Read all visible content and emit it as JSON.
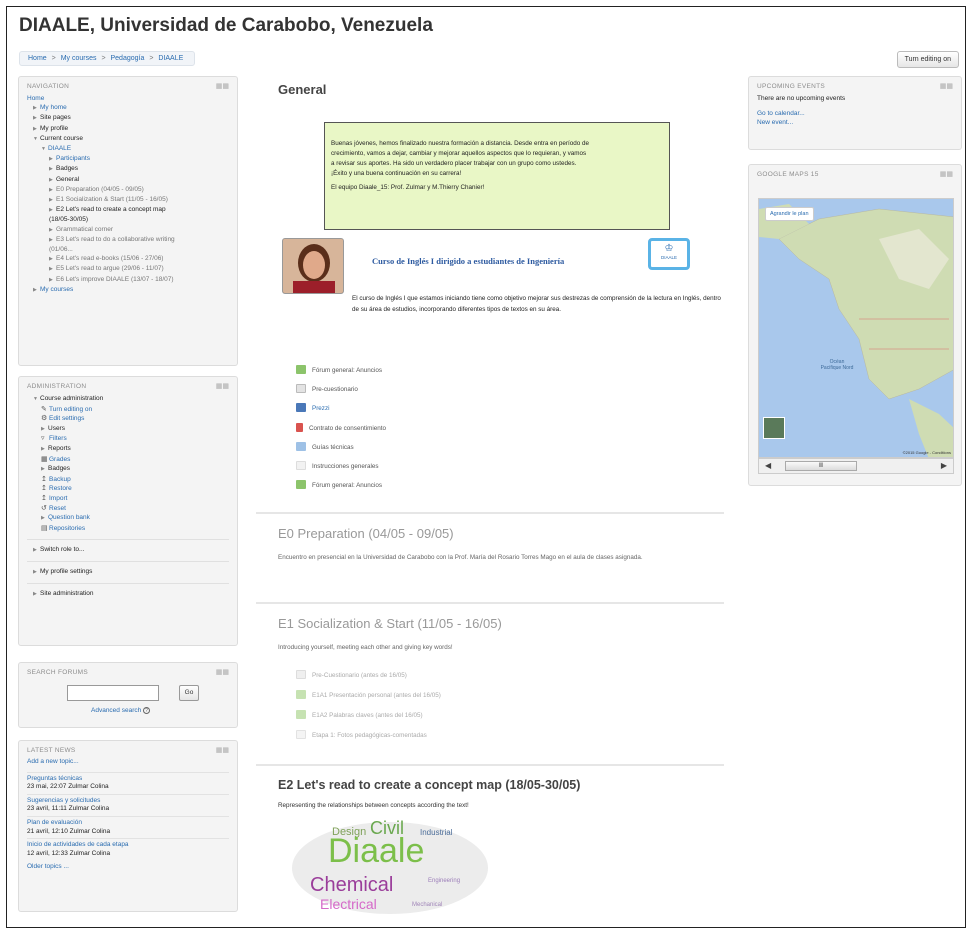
{
  "site_title": "DIAALE, Universidad de Carabobo, Venezuela",
  "breadcrumb": [
    "Home",
    "My courses",
    "Pedagogía",
    "DIAALE"
  ],
  "breadcrumb_sep": ">",
  "turn_editing_button": "Turn editing on",
  "navigation": {
    "title": "NAVIGATION",
    "home": "Home",
    "items": [
      "My home",
      "Site pages",
      "My profile",
      "Current course"
    ],
    "course": "DIAALE",
    "course_items": [
      "Participants",
      "Badges",
      "General",
      "E0 Preparation (04/05 - 09/05)",
      "E1 Socialization & Start (11/05 - 16/05)",
      "E2 Let's read to create a concept map (18/05-30/05)",
      "Grammatical corner",
      "E3 Let's read to do a collaborative writing (01/06...",
      "E4 Let's read e-books (15/06 - 27/06)",
      "E5 Let's read to argue (29/06 - 11/07)",
      "E6 Let's improve DIAALE (13/07 - 18/07)"
    ],
    "my_courses": "My courses"
  },
  "administration": {
    "title": "ADMINISTRATION",
    "course_admin": "Course administration",
    "items": [
      {
        "label": "Turn editing on",
        "icon": "pencil-icon"
      },
      {
        "label": "Edit settings",
        "icon": "gear-icon"
      },
      {
        "label": "Users",
        "icon": "triangle-icon"
      },
      {
        "label": "Filters",
        "icon": "filter-icon"
      },
      {
        "label": "Reports",
        "icon": "triangle-icon"
      },
      {
        "label": "Grades",
        "icon": "grades-icon"
      },
      {
        "label": "Badges",
        "icon": "triangle-icon"
      },
      {
        "label": "Backup",
        "icon": "backup-icon"
      },
      {
        "label": "Restore",
        "icon": "restore-icon"
      },
      {
        "label": "Import",
        "icon": "import-icon"
      },
      {
        "label": "Reset",
        "icon": "reset-icon"
      },
      {
        "label": "Question bank",
        "icon": "triangle-icon"
      },
      {
        "label": "Repositories",
        "icon": "repository-icon"
      }
    ],
    "switch_role": "Switch role to...",
    "profile_settings": "My profile settings",
    "site_admin": "Site administration"
  },
  "search_forums": {
    "title": "SEARCH FORUMS",
    "go": "Go",
    "advanced": "Advanced search"
  },
  "latest_news": {
    "title": "LATEST NEWS",
    "add_new": "Add a new topic...",
    "items": [
      {
        "title": "Preguntas técnicas",
        "meta": "23 mai, 22:07 Zulmar Colina"
      },
      {
        "title": "Sugerencias y solicitudes",
        "meta": "23 avril, 11:11 Zulmar Colina"
      },
      {
        "title": "Plan de evaluación",
        "meta": "21 avril, 12:10 Zulmar Colina"
      },
      {
        "title": "Inicio de actividades de cada etapa",
        "meta": "12 avril, 12:33 Zulmar Colina"
      }
    ],
    "older": "Older topics ..."
  },
  "upcoming_events": {
    "title": "UPCOMING EVENTS",
    "none": "There are no upcoming events",
    "calendar": "Go to calendar...",
    "new_event": "New event..."
  },
  "google_maps": {
    "title": "GOOGLE MAPS 15",
    "button": "Agrandir le plan",
    "ocean": "Océan Pacifique Nord",
    "attribution": "©2015 Google - Conditions"
  },
  "general": {
    "title": "General",
    "notice": [
      "Buenas jóvenes, hemos finalizado nuestra formación a distancia. Desde entra en período de",
      "crecimiento, vamos a dejar, cambiar y mejorar aquellos aspectos que lo requieran, y vamos",
      "a revisar sus aportes. Ha sido un verdadero placer trabajar con un grupo como ustedes.",
      "¡Éxito y una buena continuación en su carrera!",
      "",
      "El equipo Diaale_15: Prof. Zulmar y M.Thierry Chanier!"
    ],
    "course_title": "Curso de Inglés I dirigido a estudiantes de Ingeniería",
    "logo_text": "DIAALE",
    "description": "El curso de Inglés I que estamos iniciando tiene como objetivo mejorar sus destrezas de comprensión de la lectura en Inglés, dentro de su área de estudios, incorporando diferentes tipos de textos en su área.",
    "activities": [
      {
        "label": "Fórum general: Anuncios",
        "icon": "forum-icon",
        "color": "#8cc46b"
      },
      {
        "label": "Pre-cuestionario",
        "icon": "quiz-icon",
        "color": "#d9d9d9"
      },
      {
        "label": "Prezzi",
        "icon": "resource-icon",
        "color": "#4a78b8"
      },
      {
        "label": "Contrato de consentimiento",
        "icon": "pdf-icon",
        "color": "#d9534f"
      },
      {
        "label": "Guías técnicas",
        "icon": "folder-icon",
        "color": "#9ec1e6"
      },
      {
        "label": "Instrucciones generales",
        "icon": "page-icon",
        "color": "#eeeeee"
      },
      {
        "label": "Fórum general: Anuncios",
        "icon": "forum-icon",
        "color": "#8cc46b"
      }
    ]
  },
  "e0": {
    "title": "E0 Preparation (04/05 - 09/05)",
    "summary": "Encuentro en presencial en la Universidad de Carabobo con la Prof. María del Rosario Torres Mago en el aula de clases asignada."
  },
  "e1": {
    "title": "E1 Socialization & Start (11/05 - 16/05)",
    "summary": "Introducing yourself, meeting each other and giving key words!",
    "activities": [
      "Pre-Cuestionario (antes de 16/05)",
      "E1A1 Presentación personal (antes del 16/05)",
      "E1A2 Palabras claves (antes del 16/05)",
      "Etapa 1: Fotos pedagógicas-comentadas"
    ]
  },
  "e2": {
    "title": "E2 Let's read to create a concept map (18/05-30/05)",
    "summary": "Representing the relationships between concepts according the text!",
    "wordcloud": [
      "Diaale",
      "Chemical",
      "Civil",
      "Design",
      "Electrical",
      "Industrial",
      "Engineering",
      "Mechanical"
    ]
  }
}
